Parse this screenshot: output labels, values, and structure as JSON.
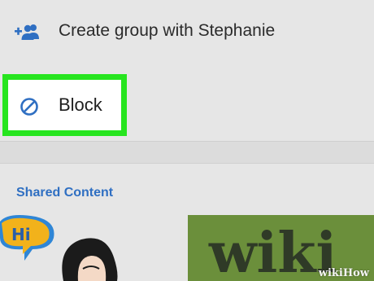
{
  "menu": {
    "create_group_label": "Create group with Stephanie",
    "create_group_icon": "add-group-icon",
    "block_label": "Block",
    "block_icon": "block-icon",
    "highlight_color": "#27e51f",
    "icon_color": "#2f6fc2"
  },
  "shared_content": {
    "title": "Shared Content",
    "thumbnails": [
      "bitmoji-sticker",
      "wikihow-logo-image"
    ]
  },
  "watermark": {
    "text": "wikiHow"
  }
}
